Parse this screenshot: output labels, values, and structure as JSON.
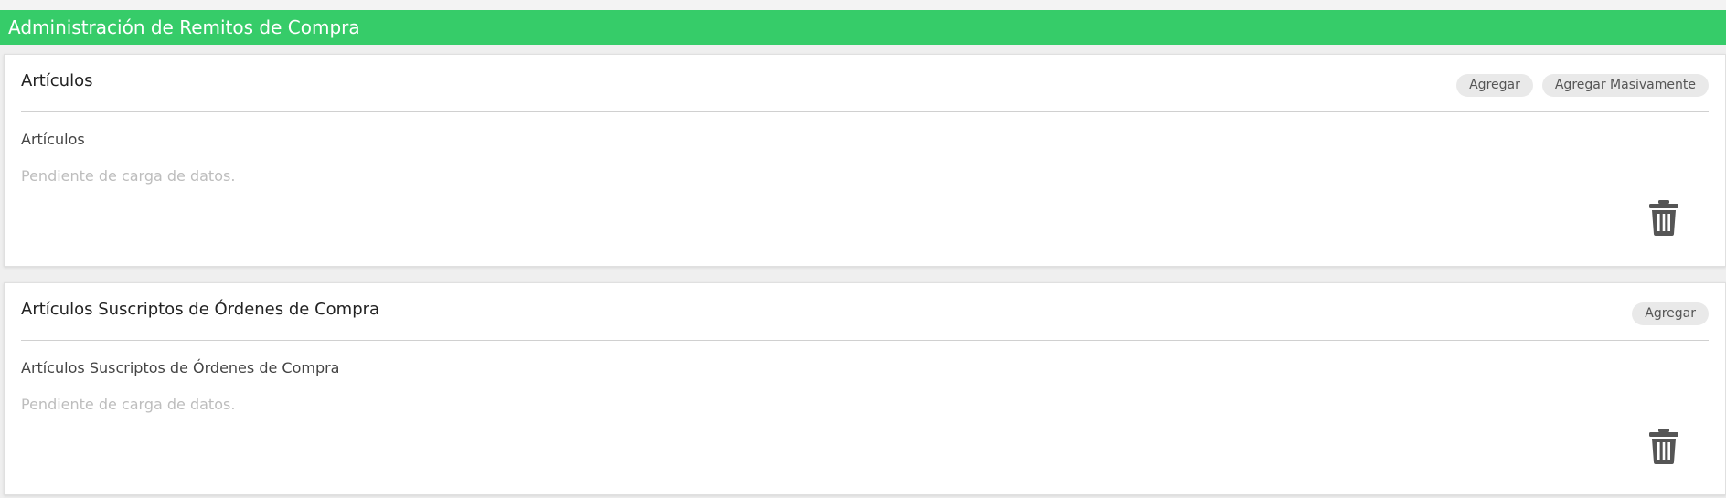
{
  "header": {
    "title": "Administración de Remitos de Compra",
    "color": "#36cc69"
  },
  "panels": [
    {
      "title": "Artículos",
      "buttons": [
        "Agregar",
        "Agregar Masivamente"
      ],
      "section_label": "Artículos",
      "empty_text": "Pendiente de carga de datos.",
      "delete_icon": "trash-icon"
    },
    {
      "title": "Artículos Suscriptos de Órdenes de Compra",
      "buttons": [
        "Agregar"
      ],
      "section_label": "Artículos Suscriptos de Órdenes de Compra",
      "empty_text": "Pendiente de carga de datos.",
      "delete_icon": "trash-icon"
    }
  ]
}
